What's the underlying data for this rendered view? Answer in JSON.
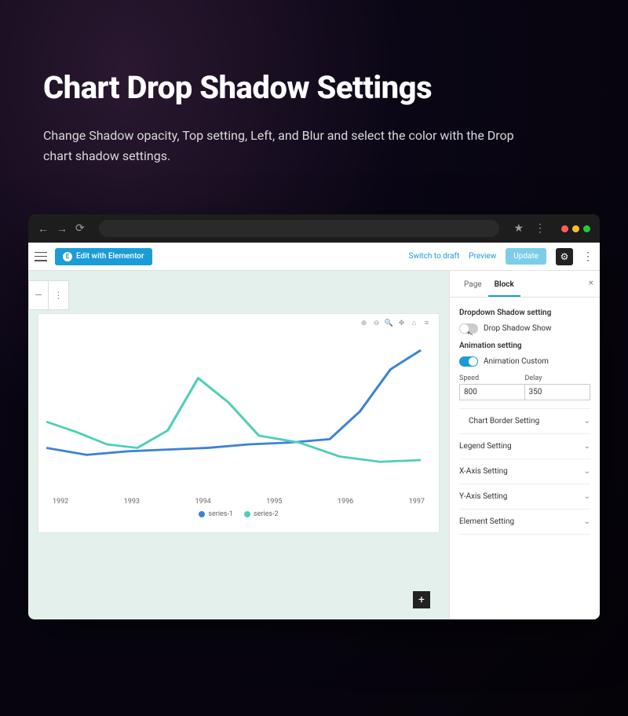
{
  "hero": {
    "title": "Chart Drop Shadow Settings",
    "subtitle": "Change Shadow opacity, Top setting, Left, and Blur and select the color with the Drop chart shadow settings."
  },
  "topbar": {
    "edit_label": "Edit with Elementor",
    "switch_draft": "Switch to draft",
    "preview": "Preview",
    "update": "Update"
  },
  "inspector": {
    "tab_page": "Page",
    "tab_block": "Block",
    "dropdown_section": "Dropdown Shadow setting",
    "drop_shadow_label": "Drop Shadow Show",
    "animation_section": "Animation setting",
    "animation_custom_label": "Animation Custom",
    "speed_label": "Speed",
    "delay_label": "Delay",
    "speed_value": "800",
    "delay_value": "350",
    "acc_chart_border": "Chart Border Setting",
    "acc_legend": "Legend Setting",
    "acc_xaxis": "X-Axis Setting",
    "acc_yaxis": "Y-Axis Setting",
    "acc_element": "Element Setting"
  },
  "chart": {
    "legend_s1": "series-1",
    "legend_s2": "series-2",
    "x_labels": [
      "1992",
      "1993",
      "1994",
      "1995",
      "1996",
      "1997"
    ]
  },
  "chart_data": {
    "type": "line",
    "title": "",
    "xlabel": "",
    "ylabel": "",
    "categories": [
      "1992",
      "1993",
      "1994",
      "1995",
      "1996",
      "1997"
    ],
    "series": [
      {
        "name": "series-1",
        "values": [
          28,
          24,
          28,
          32,
          34,
          90
        ]
      },
      {
        "name": "series-2",
        "values": [
          44,
          30,
          72,
          36,
          22,
          20
        ]
      }
    ],
    "ylim": [
      0,
      100
    ],
    "legend_position": "bottom",
    "grid": false
  }
}
